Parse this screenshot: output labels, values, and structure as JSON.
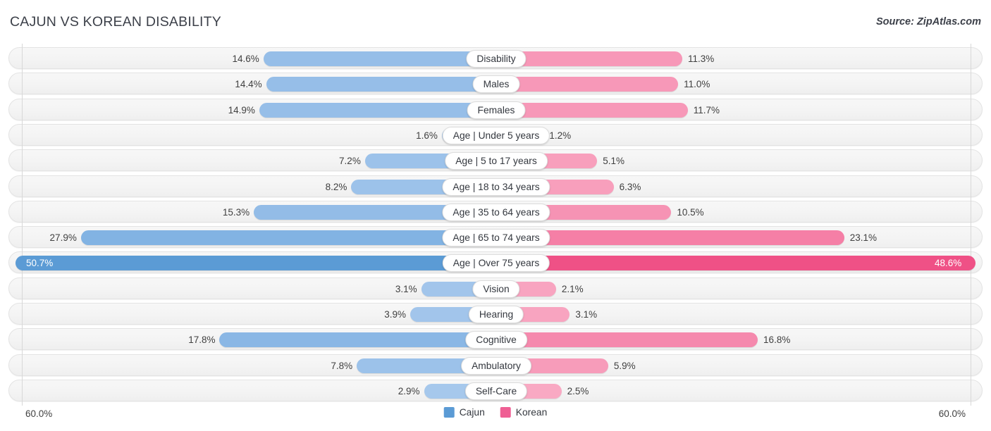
{
  "header": {
    "title": "CAJUN VS KOREAN DISABILITY",
    "source": "Source: ZipAtlas.com"
  },
  "footer": {
    "axis_left": "60.0%",
    "axis_right": "60.0%"
  },
  "legend": [
    {
      "label": "Cajun",
      "color": "#5b9bd5"
    },
    {
      "label": "Korean",
      "color": "#ef5f94"
    }
  ],
  "colors": {
    "cajun_light": "#96bee8",
    "cajun_dark": "#5b9bd5",
    "korean_light": "#f798b8",
    "korean_mid": "#f47fa7",
    "korean_dark": "#ef5186"
  },
  "chart_data": {
    "type": "bar",
    "orientation": "diverging-horizontal",
    "title": "CAJUN VS KOREAN DISABILITY",
    "subtitle": "Source: ZipAtlas.com",
    "xlabel": "",
    "ylabel": "",
    "xlim": [
      60.0,
      60.0
    ],
    "axis_max": 60.0,
    "grid": false,
    "legend_position": "bottom-center",
    "categories": [
      "Disability",
      "Males",
      "Females",
      "Age | Under 5 years",
      "Age | 5 to 17 years",
      "Age | 18 to 34 years",
      "Age | 35 to 64 years",
      "Age | 65 to 74 years",
      "Age | Over 75 years",
      "Vision",
      "Hearing",
      "Cognitive",
      "Ambulatory",
      "Self-Care"
    ],
    "series": [
      {
        "name": "Cajun",
        "color": "#5b9bd5",
        "values": [
          14.6,
          14.4,
          14.9,
          1.6,
          7.2,
          8.2,
          15.3,
          27.9,
          50.7,
          3.1,
          3.9,
          17.8,
          7.8,
          2.9
        ]
      },
      {
        "name": "Korean",
        "color": "#ef5f94",
        "values": [
          11.3,
          11.0,
          11.7,
          1.2,
          5.1,
          6.3,
          10.5,
          23.1,
          48.6,
          2.1,
          3.1,
          16.8,
          5.9,
          2.5
        ]
      }
    ],
    "labels": {
      "Cajun": [
        "14.6%",
        "14.4%",
        "14.9%",
        "1.6%",
        "7.2%",
        "8.2%",
        "15.3%",
        "27.9%",
        "50.7%",
        "3.1%",
        "3.9%",
        "17.8%",
        "7.8%",
        "2.9%"
      ],
      "Korean": [
        "11.3%",
        "11.0%",
        "11.7%",
        "1.2%",
        "5.1%",
        "6.3%",
        "10.5%",
        "23.1%",
        "48.6%",
        "2.1%",
        "3.1%",
        "16.8%",
        "5.9%",
        "2.5%"
      ]
    }
  },
  "rows": [
    {
      "category": "Disability",
      "left_label": "14.6%",
      "right_label": "11.3%",
      "left_value": 14.6,
      "right_value": 11.3,
      "left_color": "#96bee8",
      "right_color": "#f798b8",
      "label_inside": false
    },
    {
      "category": "Males",
      "left_label": "14.4%",
      "right_label": "11.0%",
      "left_value": 14.4,
      "right_value": 11.0,
      "left_color": "#96bee8",
      "right_color": "#f798b8",
      "label_inside": false
    },
    {
      "category": "Females",
      "left_label": "14.9%",
      "right_label": "11.7%",
      "left_value": 14.9,
      "right_value": 11.7,
      "left_color": "#96bee8",
      "right_color": "#f798b8",
      "label_inside": false
    },
    {
      "category": "Age | Under 5 years",
      "left_label": "1.6%",
      "right_label": "1.2%",
      "left_value": 1.6,
      "right_value": 1.2,
      "left_color": "#a6c8ec",
      "right_color": "#f9a9c3",
      "label_inside": false
    },
    {
      "category": "Age | 5 to 17 years",
      "left_label": "7.2%",
      "right_label": "5.1%",
      "left_value": 7.2,
      "right_value": 5.1,
      "left_color": "#9cc2ea",
      "right_color": "#f89fbc",
      "label_inside": false
    },
    {
      "category": "Age | 18 to 34 years",
      "left_label": "8.2%",
      "right_label": "6.3%",
      "left_value": 8.2,
      "right_value": 6.3,
      "left_color": "#9cc2ea",
      "right_color": "#f89fbc",
      "label_inside": false
    },
    {
      "category": "Age | 35 to 64 years",
      "left_label": "15.3%",
      "right_label": "10.5%",
      "left_value": 15.3,
      "right_value": 10.5,
      "left_color": "#93bce7",
      "right_color": "#f693b4",
      "label_inside": false
    },
    {
      "category": "Age | 65 to 74 years",
      "left_label": "27.9%",
      "right_label": "23.1%",
      "left_value": 27.9,
      "right_value": 23.1,
      "left_color": "#82b3e3",
      "right_color": "#f57fa6",
      "label_inside": false
    },
    {
      "category": "Age | Over 75 years",
      "left_label": "50.7%",
      "right_label": "48.6%",
      "left_value": 50.7,
      "right_value": 48.6,
      "left_color": "#5b9bd5",
      "right_color": "#ef5186",
      "label_inside": true
    },
    {
      "category": "Vision",
      "left_label": "3.1%",
      "right_label": "2.1%",
      "left_value": 3.1,
      "right_value": 2.1,
      "left_color": "#a2c5eb",
      "right_color": "#f8a4c0",
      "label_inside": false
    },
    {
      "category": "Hearing",
      "left_label": "3.9%",
      "right_label": "3.1%",
      "left_value": 3.9,
      "right_value": 3.1,
      "left_color": "#a2c5eb",
      "right_color": "#f8a4c0",
      "label_inside": false
    },
    {
      "category": "Cognitive",
      "left_label": "17.8%",
      "right_label": "16.8%",
      "left_value": 17.8,
      "right_value": 16.8,
      "left_color": "#8ab7e5",
      "right_color": "#f589ad",
      "label_inside": false
    },
    {
      "category": "Ambulatory",
      "left_label": "7.8%",
      "right_label": "5.9%",
      "left_value": 7.8,
      "right_value": 5.9,
      "left_color": "#9cc2ea",
      "right_color": "#f79cba",
      "label_inside": false
    },
    {
      "category": "Self-Care",
      "left_label": "2.9%",
      "right_label": "2.5%",
      "left_value": 2.9,
      "right_value": 2.5,
      "left_color": "#a6c8ec",
      "right_color": "#f9a9c3",
      "label_inside": false
    }
  ]
}
